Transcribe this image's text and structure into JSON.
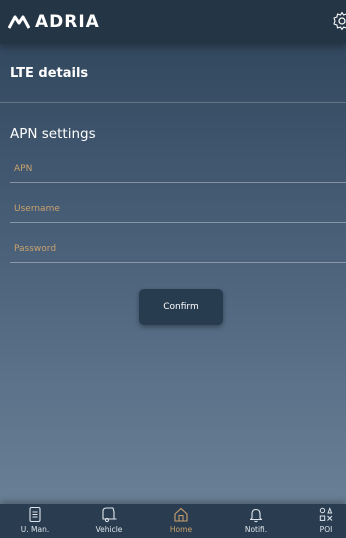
{
  "header": {
    "brand": "ADRIA",
    "logo_icon": "adria-logo-icon",
    "settings_icon": "gear-icon"
  },
  "lte": {
    "title": "LTE details"
  },
  "apn": {
    "title": "APN settings",
    "fields": [
      {
        "name": "apn",
        "placeholder": "APN",
        "value": ""
      },
      {
        "name": "username",
        "placeholder": "Username",
        "value": ""
      },
      {
        "name": "password",
        "placeholder": "Password",
        "value": ""
      }
    ],
    "confirm_label": "Confirm"
  },
  "nav": {
    "items": [
      {
        "label": "U. Man.",
        "icon": "manual-icon",
        "active": false
      },
      {
        "label": "Vehicle",
        "icon": "vehicle-icon",
        "active": false
      },
      {
        "label": "Home",
        "icon": "home-icon",
        "active": true
      },
      {
        "label": "Notifi.",
        "icon": "bell-icon",
        "active": false
      },
      {
        "label": "POI",
        "icon": "poi-icon",
        "active": false
      }
    ]
  },
  "colors": {
    "accent": "#c9a16e",
    "topbar": "#243646",
    "button": "#283c50"
  }
}
